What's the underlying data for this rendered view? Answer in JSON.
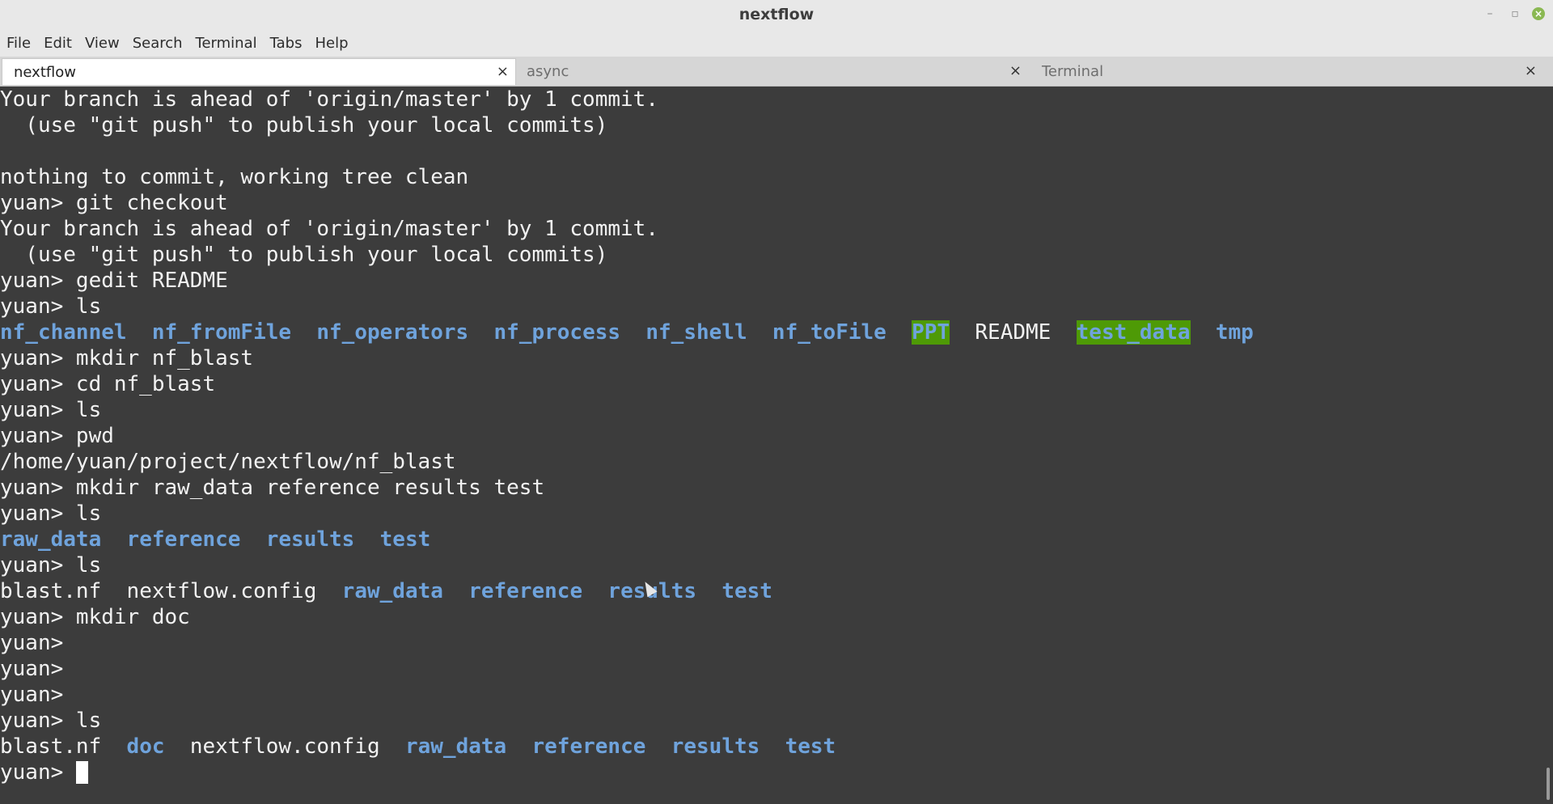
{
  "window": {
    "title": "nextflow"
  },
  "menu": [
    "File",
    "Edit",
    "View",
    "Search",
    "Terminal",
    "Tabs",
    "Help"
  ],
  "tabs": [
    {
      "label": "nextflow",
      "active": true
    },
    {
      "label": "async",
      "active": false
    },
    {
      "label": "Terminal",
      "active": false
    }
  ],
  "terminal": {
    "lines": [
      [
        {
          "t": "Your branch is ahead of 'origin/master' by 1 commit."
        }
      ],
      [
        {
          "t": "  (use \"git push\" to publish your local commits)"
        }
      ],
      [
        {
          "t": ""
        }
      ],
      [
        {
          "t": "nothing to commit, working tree clean"
        }
      ],
      [
        {
          "t": "yuan> git checkout"
        }
      ],
      [
        {
          "t": "Your branch is ahead of 'origin/master' by 1 commit."
        }
      ],
      [
        {
          "t": "  (use \"git push\" to publish your local commits)"
        }
      ],
      [
        {
          "t": "yuan> gedit README"
        }
      ],
      [
        {
          "t": "yuan> ls"
        }
      ],
      [
        {
          "t": "nf_channel",
          "k": "dir"
        },
        {
          "t": "  "
        },
        {
          "t": "nf_fromFile",
          "k": "dir"
        },
        {
          "t": "  "
        },
        {
          "t": "nf_operators",
          "k": "dir"
        },
        {
          "t": "  "
        },
        {
          "t": "nf_process",
          "k": "dir"
        },
        {
          "t": "  "
        },
        {
          "t": "nf_shell",
          "k": "dir"
        },
        {
          "t": "  "
        },
        {
          "t": "nf_toFile",
          "k": "dir"
        },
        {
          "t": "  "
        },
        {
          "t": "PPT",
          "k": "hl"
        },
        {
          "t": "  "
        },
        {
          "t": "README",
          "k": "file"
        },
        {
          "t": "  "
        },
        {
          "t": "test_data",
          "k": "hl"
        },
        {
          "t": "  "
        },
        {
          "t": "tmp",
          "k": "dir"
        }
      ],
      [
        {
          "t": "yuan> mkdir nf_blast"
        }
      ],
      [
        {
          "t": "yuan> cd nf_blast"
        }
      ],
      [
        {
          "t": "yuan> ls"
        }
      ],
      [
        {
          "t": "yuan> pwd"
        }
      ],
      [
        {
          "t": "/home/yuan/project/nextflow/nf_blast"
        }
      ],
      [
        {
          "t": "yuan> mkdir raw_data reference results test"
        }
      ],
      [
        {
          "t": "yuan> ls"
        }
      ],
      [
        {
          "t": "raw_data",
          "k": "dir"
        },
        {
          "t": "  "
        },
        {
          "t": "reference",
          "k": "dir"
        },
        {
          "t": "  "
        },
        {
          "t": "results",
          "k": "dir"
        },
        {
          "t": "  "
        },
        {
          "t": "test",
          "k": "dir"
        }
      ],
      [
        {
          "t": "yuan> ls"
        }
      ],
      [
        {
          "t": "blast.nf",
          "k": "file"
        },
        {
          "t": "  "
        },
        {
          "t": "nextflow.config",
          "k": "file"
        },
        {
          "t": "  "
        },
        {
          "t": "raw_data",
          "k": "dir"
        },
        {
          "t": "  "
        },
        {
          "t": "reference",
          "k": "dir"
        },
        {
          "t": "  "
        },
        {
          "t": "results",
          "k": "dir"
        },
        {
          "t": "  "
        },
        {
          "t": "test",
          "k": "dir"
        }
      ],
      [
        {
          "t": "yuan> mkdir doc"
        }
      ],
      [
        {
          "t": "yuan> "
        }
      ],
      [
        {
          "t": "yuan> "
        }
      ],
      [
        {
          "t": "yuan> "
        }
      ],
      [
        {
          "t": "yuan> ls"
        }
      ],
      [
        {
          "t": "blast.nf",
          "k": "file"
        },
        {
          "t": "  "
        },
        {
          "t": "doc",
          "k": "dir"
        },
        {
          "t": "  "
        },
        {
          "t": "nextflow.config",
          "k": "file"
        },
        {
          "t": "  "
        },
        {
          "t": "raw_data",
          "k": "dir"
        },
        {
          "t": "  "
        },
        {
          "t": "reference",
          "k": "dir"
        },
        {
          "t": "  "
        },
        {
          "t": "results",
          "k": "dir"
        },
        {
          "t": "  "
        },
        {
          "t": "test",
          "k": "dir"
        }
      ],
      [
        {
          "t": "yuan> "
        },
        {
          "t": "",
          "k": "cursor"
        }
      ]
    ]
  }
}
